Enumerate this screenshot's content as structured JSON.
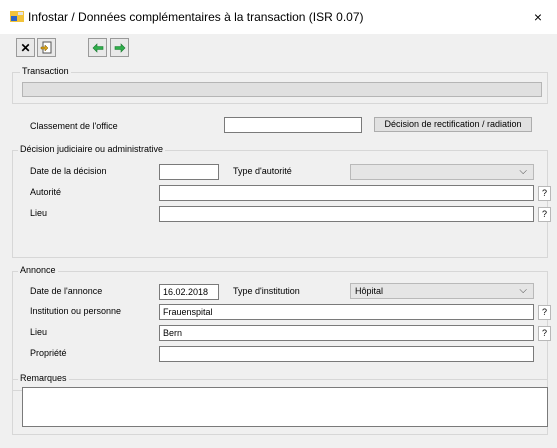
{
  "window": {
    "title": "Infostar / Données complémentaires à la transaction (ISR 0.07)",
    "close_glyph": "×"
  },
  "toolbar": {
    "close_glyph": "✕",
    "import_icon": "import-document-icon",
    "prev_icon": "arrow-left-icon",
    "next_icon": "arrow-right-icon",
    "accent": "#1e9e3e"
  },
  "transaction": {
    "label": "Transaction",
    "value": ""
  },
  "office": {
    "label": "Classement de l'office",
    "value": "",
    "button": "Décision de rectification / radiation"
  },
  "decision": {
    "label": "Décision judiciaire ou administrative",
    "date_label": "Date de la décision",
    "date_value": "",
    "authority_type_label": "Type d'autorité",
    "authority_type_value": "",
    "authority_label": "Autorité",
    "authority_value": "",
    "place_label": "Lieu",
    "place_value": "",
    "help": "?"
  },
  "announcement": {
    "label": "Annonce",
    "date_label": "Date de l'annonce",
    "date_value": "16.02.2018",
    "institution_type_label": "Type d'institution",
    "institution_type_value": "Hôpital",
    "institution_label": "Institution ou personne",
    "institution_value": "Frauenspital",
    "place_label": "Lieu",
    "place_value": "Bern",
    "property_label": "Propriété",
    "property_value": "",
    "help": "?"
  },
  "remarks": {
    "label": "Remarques",
    "value": ""
  },
  "chevron": "⌵"
}
